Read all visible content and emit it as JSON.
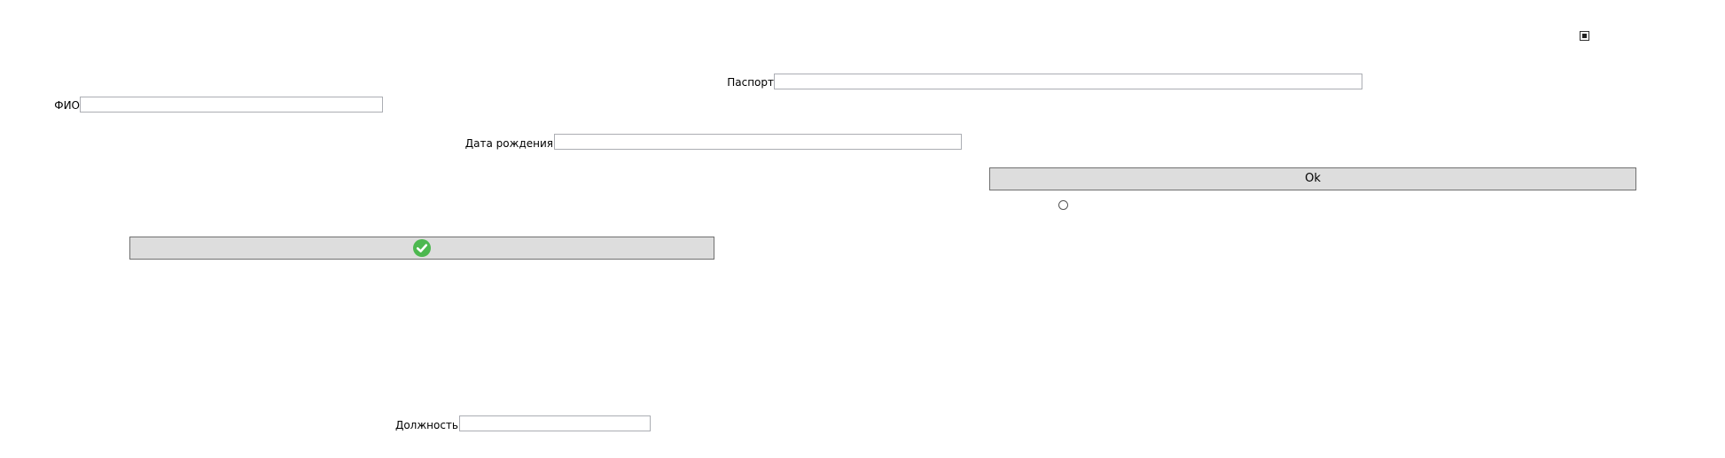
{
  "form": {
    "passport_label": "Паспорт",
    "passport_value": "",
    "fio_label": "ФИО",
    "fio_value": "",
    "birthdate_label": "Дата рождения",
    "birthdate_value": "",
    "position_label": "Должность",
    "position_value": "",
    "ok_label": "Ok",
    "checkbox_checked": true,
    "radio_selected": false,
    "check_button_icon": "check-circle-icon"
  },
  "colors": {
    "button_bg": "#dddddd",
    "button_border": "#707070",
    "field_border": "#abadb3",
    "check_green": "#4cb84f"
  }
}
